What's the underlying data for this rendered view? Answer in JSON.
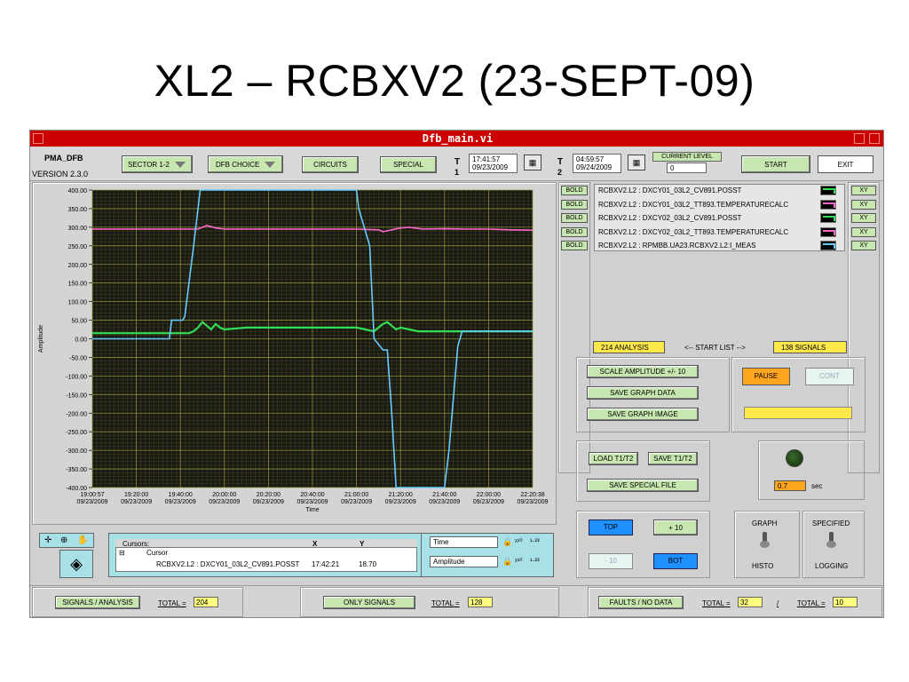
{
  "slide": {
    "title": "XL2 – RCBXV2 (23-SEPT-09)"
  },
  "window": {
    "title": "Dfb_main.vi"
  },
  "header": {
    "app_name": "PMA_DFB",
    "version": "VERSION 2.3.0",
    "sector_label": "SECTOR 1-2",
    "dfb_choice_label": "DFB CHOICE",
    "circuits_label": "CIRCUITS",
    "special_label": "SPECIAL",
    "t1_label": "T",
    "t1_sub": "1",
    "t1_time": "17:41:57",
    "t1_date": "09/23/2009",
    "t2_label": "T",
    "t2_sub": "2",
    "t2_time": "04:59:57",
    "t2_date": "09/24/2009",
    "current_level_label": "CURRENT LEVEL",
    "current_level_value": "0",
    "start_label": "START",
    "exit_label": "EXIT"
  },
  "colors": {
    "accent_green": "#c8e6b0",
    "highlight_yellow": "#ffe94a",
    "title_red": "#cc0000",
    "plot_bg": "#1a1a14",
    "grid": "#9a9a38"
  },
  "signals": [
    {
      "bold": "BOLD",
      "name": "RCBXV2.L2 : DXCY01_03L2_CV891.POSST",
      "xy": "XY",
      "color": "#33dd55"
    },
    {
      "bold": "BOLD",
      "name": "RCBXV2.L2 : DXCY01_03L2_TT893.TEMPERATURECALC",
      "xy": "XY",
      "color": "#ff66cc"
    },
    {
      "bold": "BOLD",
      "name": "RCBXV2.L2 : DXCY02_03L2_CV891.POSST",
      "xy": "XY",
      "color": "#33dd55"
    },
    {
      "bold": "BOLD",
      "name": "RCBXV2.L2 : DXCY02_03L2_TT893.TEMPERATURECALC",
      "xy": "XY",
      "color": "#ff66cc"
    },
    {
      "bold": "BOLD",
      "name": "RCBXV2.L2 : RPMBB.UA23.RCBXV2.L2:I_MEAS",
      "xy": "XY",
      "color": "#66ccff"
    }
  ],
  "analysis": {
    "analysis_count": "214 ANALYSIS",
    "start_list": "<-- START LIST -->",
    "signal_count": "138 SIGNALS",
    "scale_amp": "SCALE AMPLITUDE +/- 10",
    "save_graph_data": "SAVE GRAPH DATA",
    "save_graph_image": "SAVE GRAPH IMAGE",
    "pause": "PAUSE",
    "cont": "CONT",
    "load_t1t2": "LOAD T1/T2",
    "save_t1t2": "SAVE T1/T2",
    "save_special_file": "SAVE SPECIAL FILE",
    "delay_value": "0.7",
    "delay_unit": "sec",
    "top": "TOP",
    "plus10": "+ 10",
    "minus10": "- 10",
    "bot": "BOT",
    "graph_label": "GRAPH",
    "histo_label": "HISTO",
    "specified_label": "SPECIFIED",
    "logging_label": "LOGGING"
  },
  "cursors": {
    "header": "Cursors:",
    "col_x": "X",
    "col_y": "Y",
    "cursor_name": "Cursor",
    "signal": "RCBXV2.L2 : DXCY01_03L2_CV891.POSST",
    "x_value": "17:42:21",
    "y_value": "18.70",
    "time_label": "Time",
    "amplitude_label": "Amplitude"
  },
  "footer": {
    "signals_analysis": "SIGNALS / ANALYSIS",
    "total_label": "TOTAL =",
    "total1": "204",
    "only_signals": "ONLY SIGNALS",
    "total2": "128",
    "faults": "FAULTS / NO DATA",
    "total3": "32",
    "slash": "/",
    "total4": "10"
  },
  "chart_data": {
    "type": "line",
    "ylabel": "Amplitude",
    "xlabel": "Time",
    "ylim": [
      -400,
      400
    ],
    "y_ticks": [
      "400.00",
      "350.00",
      "300.00",
      "250.00",
      "200.00",
      "150.00",
      "100.00",
      "50.00",
      "0.00",
      "-50.00",
      "-100.00",
      "-150.00",
      "-200.00",
      "-250.00",
      "-300.00",
      "-350.00",
      "-400.00"
    ],
    "x_ticks": [
      {
        "time": "19:00:57",
        "date": "09/23/2009"
      },
      {
        "time": "19:20:00",
        "date": "09/23/2009"
      },
      {
        "time": "19:40:00",
        "date": "09/23/2009"
      },
      {
        "time": "20:00:00",
        "date": "09/23/2009"
      },
      {
        "time": "20:20:00",
        "date": "09/23/2009"
      },
      {
        "time": "20:40:00",
        "date": "09/23/2009"
      },
      {
        "time": "21:00:00",
        "date": "09/23/2009"
      },
      {
        "time": "21:20:00",
        "date": "09/23/2009"
      },
      {
        "time": "21:40:00",
        "date": "09/23/2009"
      },
      {
        "time": "22:00:00",
        "date": "09/23/2009"
      },
      {
        "time": "22:20:38",
        "date": "09/23/2009"
      }
    ],
    "series": [
      {
        "color": "#ff66cc",
        "x": [
          0,
          5,
          10,
          20,
          24,
          26,
          28,
          30,
          35,
          45,
          55,
          60,
          65,
          66,
          68,
          70,
          72,
          75,
          80,
          85,
          90,
          95,
          100
        ],
        "y": [
          295,
          295,
          295,
          295,
          295,
          305,
          298,
          295,
          295,
          295,
          295,
          295,
          293,
          288,
          293,
          298,
          300,
          295,
          296,
          295,
          295,
          293,
          292
        ]
      },
      {
        "color": "#33dd55",
        "x": [
          0,
          10,
          15,
          22,
          23,
          24,
          25,
          26,
          27,
          28,
          29,
          30,
          35,
          45,
          55,
          60,
          62,
          64,
          65,
          66,
          67,
          68,
          69,
          70,
          72,
          74,
          76,
          78,
          80,
          85,
          90,
          95,
          100
        ],
        "y": [
          15,
          15,
          15,
          15,
          20,
          30,
          45,
          35,
          25,
          40,
          30,
          25,
          30,
          30,
          30,
          30,
          25,
          20,
          30,
          40,
          45,
          35,
          25,
          30,
          25,
          20,
          20,
          20,
          20,
          20,
          20,
          20,
          20
        ]
      },
      {
        "color": "#66ccff",
        "x": [
          0,
          17.5,
          18,
          20.5,
          21,
          23,
          24.5,
          25,
          60,
          60.5,
          63,
          64,
          66,
          67,
          68,
          69,
          80,
          81,
          83,
          84,
          88,
          100
        ],
        "y": [
          0,
          0,
          50,
          50,
          60,
          250,
          400,
          400,
          400,
          350,
          250,
          0,
          -30,
          -30,
          -200,
          -400,
          -400,
          -300,
          -20,
          20,
          20,
          20
        ]
      }
    ]
  }
}
